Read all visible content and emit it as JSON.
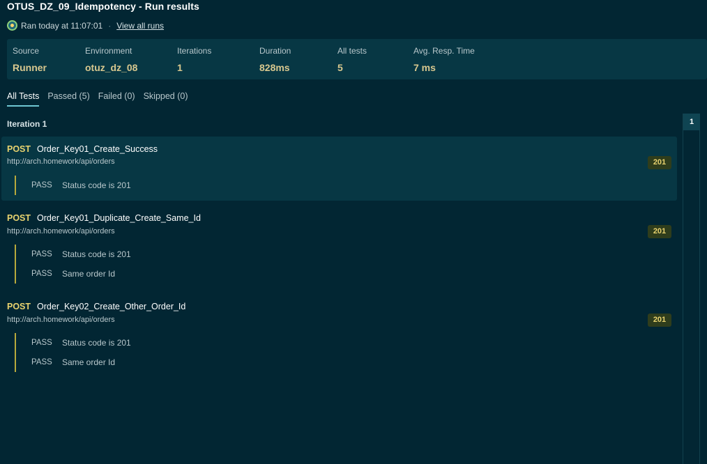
{
  "header": {
    "title": "OTUS_DZ_09_Idempotency - Run results",
    "run_text": "Ran today at 11:07:01",
    "separator": "·",
    "view_all_label": "View all runs"
  },
  "summary": {
    "source_label": "Source",
    "source_value": "Runner",
    "environment_label": "Environment",
    "environment_value": "otuz_dz_08",
    "iterations_label": "Iterations",
    "iterations_value": "1",
    "duration_label": "Duration",
    "duration_value": "828ms",
    "all_tests_label": "All tests",
    "all_tests_value": "5",
    "avg_label": "Avg. Resp. Time",
    "avg_value": "7 ms"
  },
  "tabs": [
    {
      "label": "All Tests"
    },
    {
      "label": "Passed (5)"
    },
    {
      "label": "Failed (0)"
    },
    {
      "label": "Skipped (0)"
    }
  ],
  "iteration": {
    "title": "Iteration 1",
    "requests": [
      {
        "method": "POST",
        "name": "Order_Key01_Create_Success",
        "url": "http://arch.homework/api/orders",
        "status_code": "201",
        "tests": [
          {
            "result": "PASS",
            "name": "Status code is 201"
          }
        ]
      },
      {
        "method": "POST",
        "name": "Order_Key01_Duplicate_Create_Same_Id",
        "url": "http://arch.homework/api/orders",
        "status_code": "201",
        "tests": [
          {
            "result": "PASS",
            "name": "Status code is 201"
          },
          {
            "result": "PASS",
            "name": "Same order Id"
          }
        ]
      },
      {
        "method": "POST",
        "name": "Order_Key02_Create_Other_Order_Id",
        "url": "http://arch.homework/api/orders",
        "status_code": "201",
        "tests": [
          {
            "result": "PASS",
            "name": "Status code is 201"
          },
          {
            "result": "PASS",
            "name": "Same order Id"
          }
        ]
      }
    ]
  },
  "pager": {
    "current": "1"
  },
  "colors": {
    "background": "#022633",
    "panel": "#073744",
    "method": "#e9d36f",
    "value": "#d8c88f",
    "test_border": "#b8a93c"
  },
  "icons": {
    "run_status": "runner-status-icon"
  }
}
